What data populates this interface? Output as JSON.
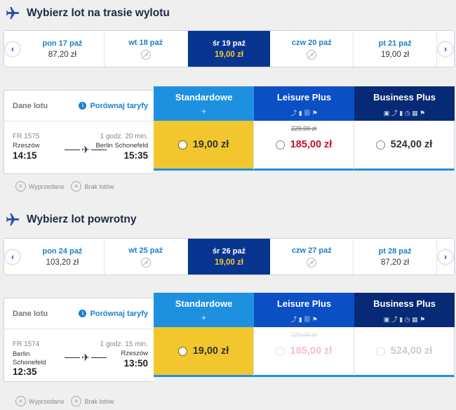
{
  "outbound": {
    "title": "Wybierz lot na trasie wylotu",
    "dates": [
      {
        "day": "pon 17 paź",
        "price": "87,20 zł"
      },
      {
        "day": "wt 18 paź",
        "price": ""
      },
      {
        "day": "śr 19 paź",
        "price": "19,00 zł"
      },
      {
        "day": "czw 20 paź",
        "price": ""
      },
      {
        "day": "pt 21 paź",
        "price": "19,00 zł"
      }
    ],
    "flight": {
      "number": "FR 1575",
      "duration": "1 godz. 20 min.",
      "from_city": "Rzeszów",
      "to_city": "Berlin Schonefeld",
      "dep": "14:15",
      "arr": "15:35"
    },
    "fares": {
      "standard": "19,00 zł",
      "leisure_old": "229,00 zł",
      "leisure": "185,00 zł",
      "business": "524,00 zł"
    }
  },
  "inbound": {
    "title": "Wybierz lot powrotny",
    "dates": [
      {
        "day": "pon 24 paź",
        "price": "103,20 zł"
      },
      {
        "day": "wt 25 paź",
        "price": ""
      },
      {
        "day": "śr 26 paź",
        "price": "19,00 zł"
      },
      {
        "day": "czw 27 paź",
        "price": ""
      },
      {
        "day": "pt 28 paź",
        "price": "87,20 zł"
      }
    ],
    "flight": {
      "number": "FR 1574",
      "duration": "1 godz. 15 min.",
      "from_city_1": "Berlin",
      "from_city_2": "Schonefeld",
      "to_city": "Rzeszów",
      "dep": "12:35",
      "arr": "13:50"
    },
    "fares": {
      "standard": "19,00 zł",
      "leisure_old": "229,00 zł",
      "leisure": "185,00 zł",
      "business": "524,00 zł"
    }
  },
  "fare_columns": {
    "standard": "Standardowe",
    "leisure": "Leisure Plus",
    "business": "Business Plus"
  },
  "left_header": {
    "label": "Dane lotu",
    "compare": "Porównaj taryfy"
  },
  "legend": {
    "sold_out": "Wyprzedano",
    "no_flights": "Brak lotów"
  },
  "colors": {
    "selected_date": "#073590",
    "selected_price": "#f6c829",
    "standard": "#1e90e0",
    "leisure": "#0b4fc4",
    "business": "#062a75",
    "standard_selected_fill": "#f2c62d",
    "leisure_price": "#c8102e"
  }
}
